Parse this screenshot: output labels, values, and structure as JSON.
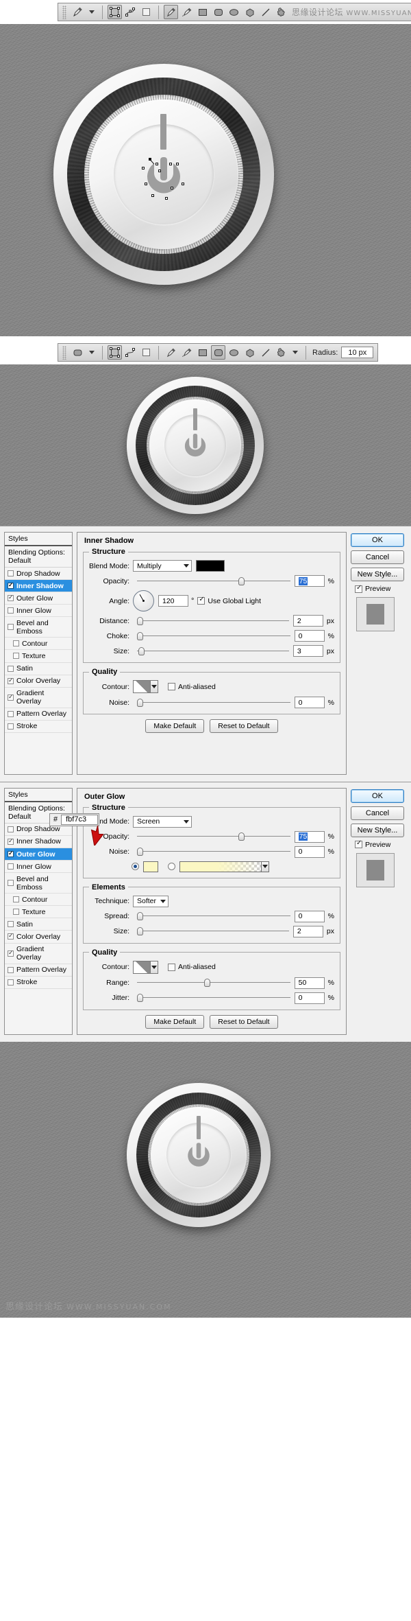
{
  "toolbar1": {
    "tool_icon": "pen-tool-icon",
    "preset_caret": "chevron-down-icon",
    "mode_icons": [
      "shape-layers-icon",
      "paths-icon",
      "fill-pixels-icon"
    ],
    "shape_icons": [
      "pen-tool-icon",
      "freeform-pen-icon",
      "rectangle-icon",
      "rounded-rectangle-icon",
      "ellipse-icon",
      "polygon-icon",
      "line-icon",
      "custom-shape-icon"
    ],
    "watermark_cn": "思缘设计论坛",
    "watermark_url": "WWW.MISSYUAN.COM"
  },
  "toolbar2": {
    "tool_icon": "rounded-rectangle-icon",
    "preset_caret": "chevron-down-icon",
    "mode_icons": [
      "shape-layers-icon",
      "paths-icon",
      "fill-pixels-icon"
    ],
    "shape_icons": [
      "pen-tool-icon",
      "freeform-pen-icon",
      "rectangle-icon",
      "rounded-rectangle-icon",
      "ellipse-icon",
      "polygon-icon",
      "line-icon",
      "custom-shape-icon"
    ],
    "extra_caret": "chevron-down-icon",
    "radius_label": "Radius:",
    "radius_value": "10 px"
  },
  "dialog_inner_shadow": {
    "styles_panel": {
      "header": "Styles",
      "blending": "Blending Options: Default",
      "items": [
        {
          "label": "Drop Shadow",
          "checked": false,
          "active": false,
          "indent": false
        },
        {
          "label": "Inner Shadow",
          "checked": true,
          "active": true,
          "indent": false
        },
        {
          "label": "Outer Glow",
          "checked": true,
          "active": false,
          "indent": false
        },
        {
          "label": "Inner Glow",
          "checked": false,
          "active": false,
          "indent": false
        },
        {
          "label": "Bevel and Emboss",
          "checked": false,
          "active": false,
          "indent": false
        },
        {
          "label": "Contour",
          "checked": false,
          "active": false,
          "indent": true
        },
        {
          "label": "Texture",
          "checked": false,
          "active": false,
          "indent": true
        },
        {
          "label": "Satin",
          "checked": false,
          "active": false,
          "indent": false
        },
        {
          "label": "Color Overlay",
          "checked": true,
          "active": false,
          "indent": false
        },
        {
          "label": "Gradient Overlay",
          "checked": true,
          "active": false,
          "indent": false
        },
        {
          "label": "Pattern Overlay",
          "checked": false,
          "active": false,
          "indent": false
        },
        {
          "label": "Stroke",
          "checked": false,
          "active": false,
          "indent": false
        }
      ]
    },
    "section_title": "Inner Shadow",
    "structure": {
      "legend": "Structure",
      "blend_mode_label": "Blend Mode:",
      "blend_mode_value": "Multiply",
      "color_swatch": "#000000",
      "opacity_label": "Opacity:",
      "opacity_value": "75",
      "opacity_unit": "%",
      "angle_label": "Angle:",
      "angle_value": "120",
      "angle_unit": "°",
      "global_light_label": "Use Global Light",
      "global_light_checked": true,
      "distance_label": "Distance:",
      "distance_value": "2",
      "distance_unit": "px",
      "choke_label": "Choke:",
      "choke_value": "0",
      "choke_unit": "%",
      "size_label": "Size:",
      "size_value": "3",
      "size_unit": "px"
    },
    "quality": {
      "legend": "Quality",
      "contour_label": "Contour:",
      "antialiased_label": "Anti-aliased",
      "antialiased_checked": false,
      "noise_label": "Noise:",
      "noise_value": "0",
      "noise_unit": "%"
    },
    "make_default": "Make Default",
    "reset_default": "Reset to Default",
    "buttons": {
      "ok": "OK",
      "cancel": "Cancel",
      "new_style": "New Style...",
      "preview_label": "Preview",
      "preview_checked": true
    }
  },
  "dialog_outer_glow": {
    "styles_panel": {
      "header": "Styles",
      "blending": "Blending Options: Default",
      "items": [
        {
          "label": "Drop Shadow",
          "checked": false,
          "active": false,
          "indent": false
        },
        {
          "label": "Inner Shadow",
          "checked": true,
          "active": false,
          "indent": false
        },
        {
          "label": "Outer Glow",
          "checked": true,
          "active": true,
          "indent": false
        },
        {
          "label": "Inner Glow",
          "checked": false,
          "active": false,
          "indent": false
        },
        {
          "label": "Bevel and Emboss",
          "checked": false,
          "active": false,
          "indent": false
        },
        {
          "label": "Contour",
          "checked": false,
          "active": false,
          "indent": true
        },
        {
          "label": "Texture",
          "checked": false,
          "active": false,
          "indent": true
        },
        {
          "label": "Satin",
          "checked": false,
          "active": false,
          "indent": false
        },
        {
          "label": "Color Overlay",
          "checked": true,
          "active": false,
          "indent": false
        },
        {
          "label": "Gradient Overlay",
          "checked": true,
          "active": false,
          "indent": false
        },
        {
          "label": "Pattern Overlay",
          "checked": false,
          "active": false,
          "indent": false
        },
        {
          "label": "Stroke",
          "checked": false,
          "active": false,
          "indent": false
        }
      ]
    },
    "section_title": "Outer Glow",
    "structure": {
      "legend": "Structure",
      "blend_mode_label": "Blend Mode:",
      "blend_mode_value": "Screen",
      "opacity_label": "Opacity:",
      "opacity_value": "75",
      "opacity_unit": "%",
      "noise_label": "Noise:",
      "noise_value": "0",
      "noise_unit": "%",
      "color_swatch": "#fbf7c3",
      "color_radio_selected": true,
      "gradient_radio_selected": false
    },
    "elements": {
      "legend": "Elements",
      "technique_label": "Technique:",
      "technique_value": "Softer",
      "spread_label": "Spread:",
      "spread_value": "0",
      "spread_unit": "%",
      "size_label": "Size:",
      "size_value": "2",
      "size_unit": "px"
    },
    "quality": {
      "legend": "Quality",
      "contour_label": "Contour:",
      "antialiased_label": "Anti-aliased",
      "antialiased_checked": false,
      "range_label": "Range:",
      "range_value": "50",
      "range_unit": "%",
      "jitter_label": "Jitter:",
      "jitter_value": "0",
      "jitter_unit": "%"
    },
    "make_default": "Make Default",
    "reset_default": "Reset to Default",
    "buttons": {
      "ok": "OK",
      "cancel": "Cancel",
      "new_style": "New Style...",
      "preview_label": "Preview",
      "preview_checked": true
    },
    "hex_tooltip": {
      "hash": "#",
      "value": "fbf7c3"
    }
  },
  "footer": {
    "watermark_cn": "思缘设计论坛",
    "watermark_url": "WWW.MISSYUAN.COM"
  }
}
